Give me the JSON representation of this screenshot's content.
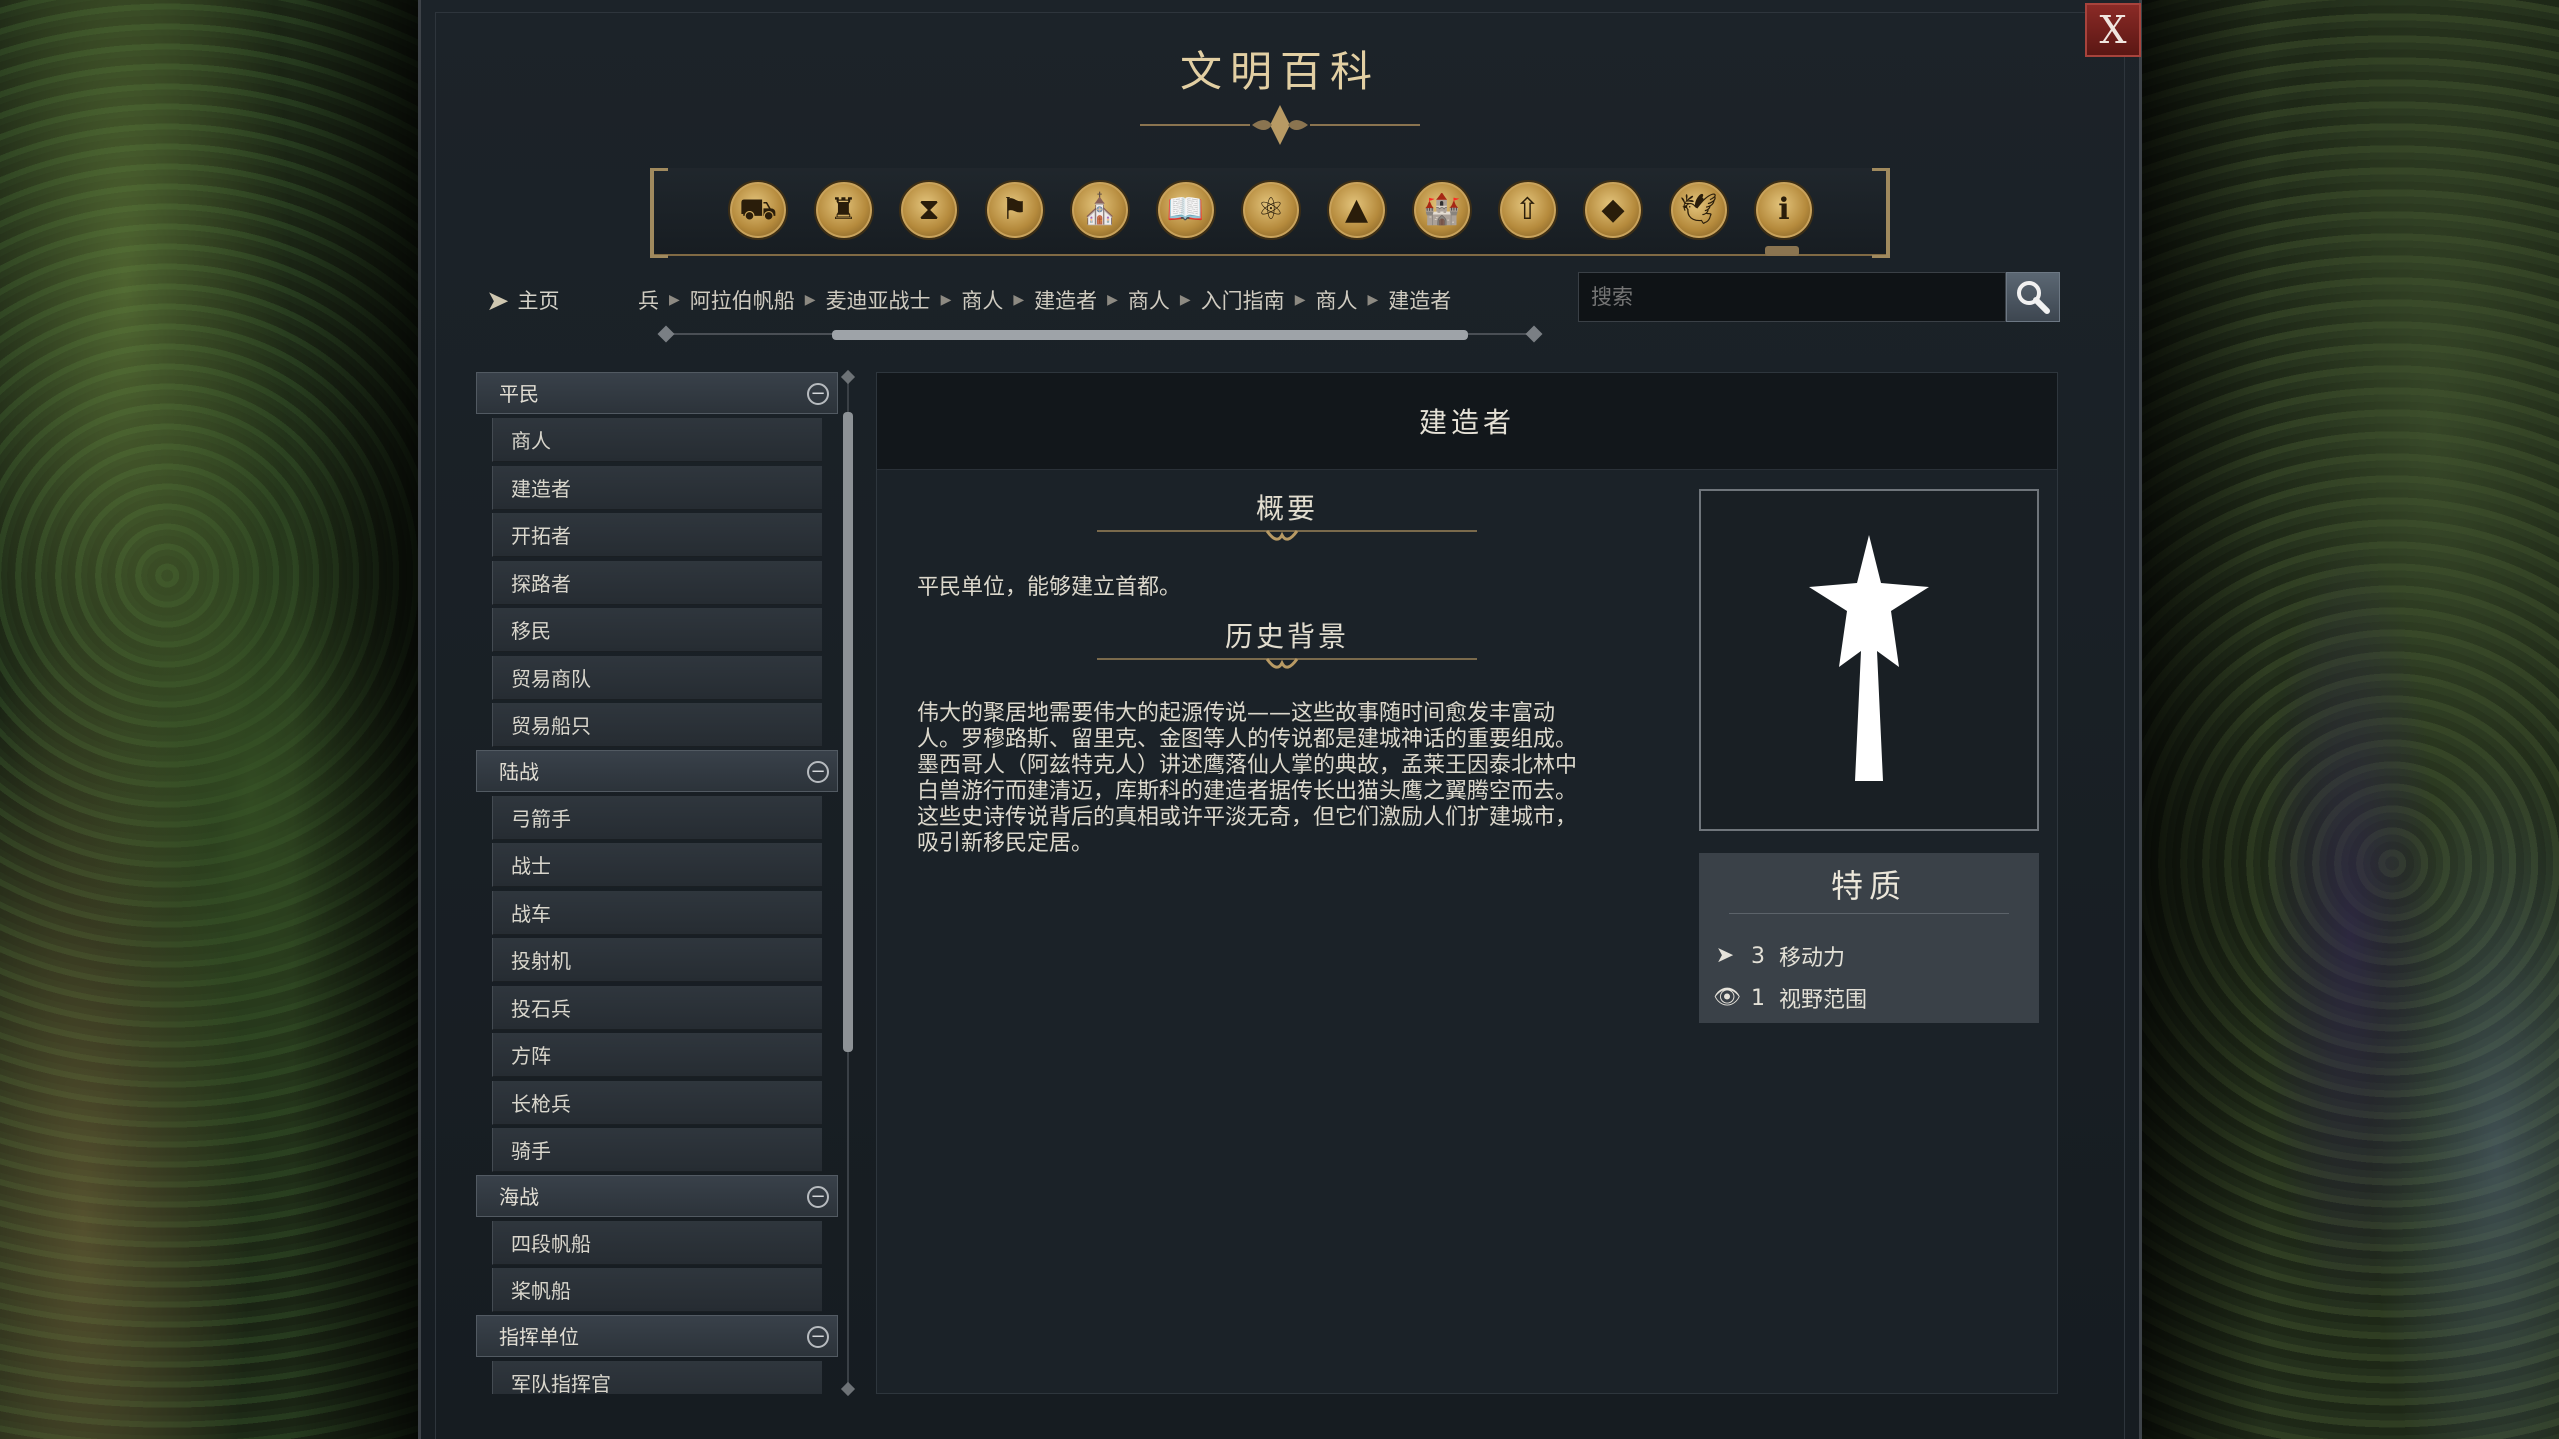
{
  "window": {
    "title": "文明百科",
    "close_label": "X"
  },
  "category_bar": {
    "icons": [
      {
        "name": "units-icon",
        "glyph": "⛟"
      },
      {
        "name": "goblet-icon",
        "glyph": "♜"
      },
      {
        "name": "hourglass-icon",
        "glyph": "⧗"
      },
      {
        "name": "flag-icon",
        "glyph": "⚑"
      },
      {
        "name": "government-icon",
        "glyph": "⛪"
      },
      {
        "name": "book-icon",
        "glyph": "📖"
      },
      {
        "name": "atom-icon",
        "glyph": "⚛"
      },
      {
        "name": "terrain-icon",
        "glyph": "▲"
      },
      {
        "name": "buildings-icon",
        "glyph": "🏰"
      },
      {
        "name": "upgrade-icon",
        "glyph": "⇧"
      },
      {
        "name": "resource-icon",
        "glyph": "◆"
      },
      {
        "name": "dove-icon",
        "glyph": "🕊"
      },
      {
        "name": "info-icon",
        "glyph": "ℹ"
      }
    ],
    "active_index": 12
  },
  "nav": {
    "home_label": "主页",
    "breadcrumbs": [
      "兵",
      "阿拉伯帆船",
      "麦迪亚战士",
      "商人",
      "建造者",
      "商人",
      "入门指南",
      "商人",
      "建造者"
    ]
  },
  "search": {
    "placeholder": "搜索"
  },
  "sidebar": {
    "groups": [
      {
        "label": "平民",
        "items": [
          "商人",
          "建造者",
          "开拓者",
          "探路者",
          "移民",
          "贸易商队",
          "贸易船只"
        ]
      },
      {
        "label": "陆战",
        "items": [
          "弓箭手",
          "战士",
          "战车",
          "投射机",
          "投石兵",
          "方阵",
          "长枪兵",
          "骑手"
        ]
      },
      {
        "label": "海战",
        "items": [
          "四段帆船",
          "桨帆船"
        ]
      },
      {
        "label": "指挥单位",
        "items": [
          "军队指挥官"
        ]
      }
    ]
  },
  "article": {
    "title": "建造者",
    "summary_heading": "概要",
    "summary_text": "平民单位，能够建立首都。",
    "history_heading": "历史背景",
    "history_lines": [
      "伟大的聚居地需要伟大的起源传说——这些故事随时间愈发丰富动",
      "人。罗穆路斯、留里克、金图等人的传说都是建城神话的重要组成。",
      "墨西哥人（阿兹特克人）讲述鹰落仙人掌的典故，孟莱王因泰北林中",
      "白兽游行而建清迈，库斯科的建造者据传长出猫头鹰之翼腾空而去。",
      "这些史诗传说背后的真相或许平淡无奇，但它们激励人们扩建城市，",
      "吸引新移民定居。"
    ],
    "traits_heading": "特质",
    "traits": [
      {
        "icon": "movement-arrow-icon",
        "glyph": "➤",
        "value": "3",
        "label": "移动力"
      },
      {
        "icon": "eye-icon",
        "glyph": "👁",
        "value": "1",
        "label": "视野范围"
      }
    ],
    "portrait_icon": "builder-unit-icon"
  },
  "colors": {
    "accent_gold": "#c8a25c",
    "close_red": "#8a2a26",
    "panel_dark": "#1b2228"
  }
}
